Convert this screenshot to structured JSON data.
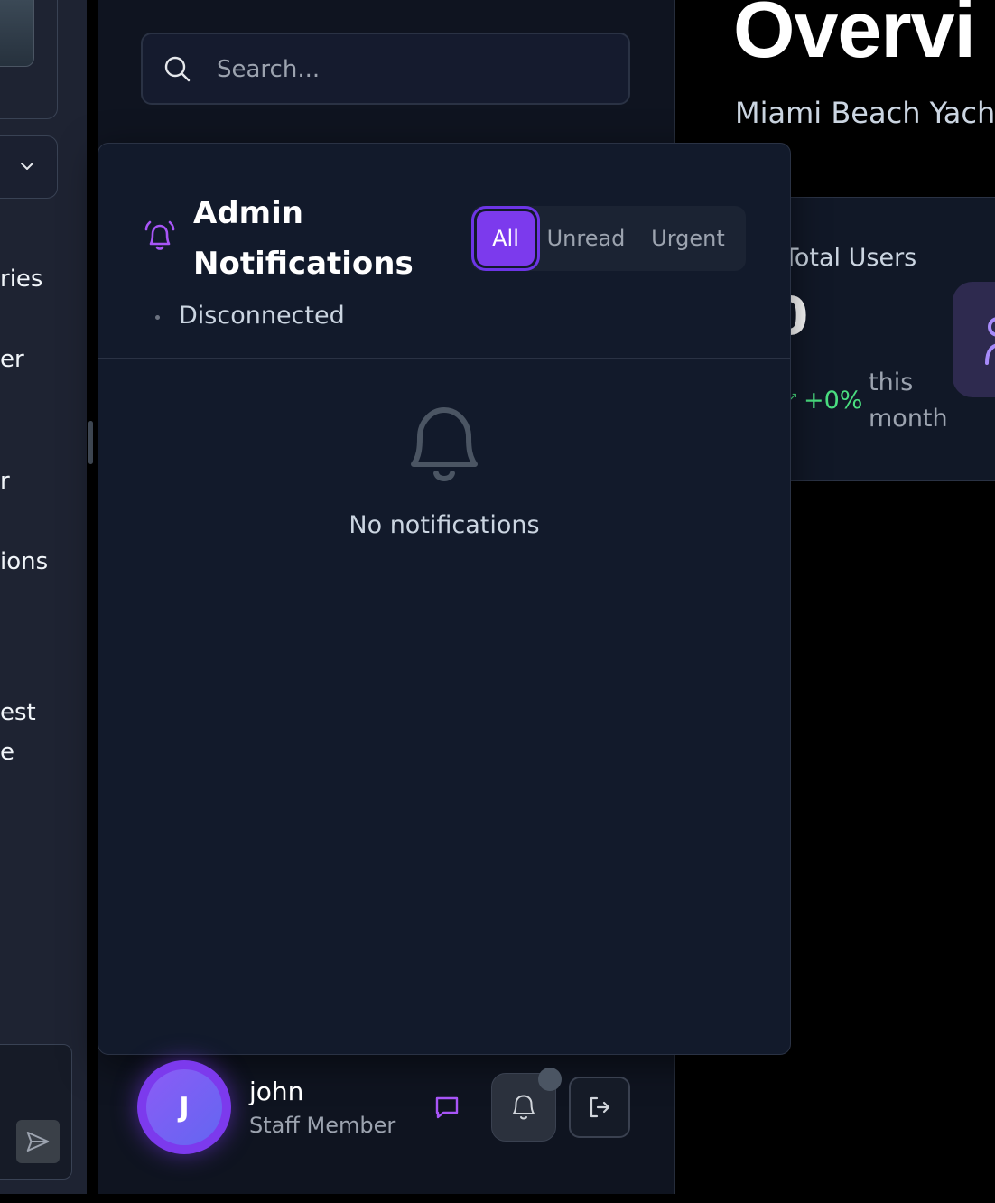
{
  "left_panel": {
    "items": [
      "ries",
      "er",
      "r",
      "ions",
      "est",
      "e"
    ]
  },
  "search": {
    "placeholder": "Search..."
  },
  "main": {
    "title": "Overvi",
    "subtitle": "Miami Beach Yach"
  },
  "stat_card": {
    "label": "Total Users",
    "value": "0",
    "trend": "+0%",
    "period": "this month"
  },
  "notifications": {
    "title": "Admin Notifications",
    "status": "Disconnected",
    "filters": {
      "all": "All",
      "unread": "Unread",
      "urgent": "Urgent"
    },
    "active_filter": "All",
    "empty_text": "No notifications"
  },
  "user": {
    "initial": "J",
    "name": "john",
    "role": "Staff Member"
  },
  "colors": {
    "accent": "#7c3aed",
    "trend_positive": "#4ade80",
    "panel_bg": "#121a2b",
    "page_bg": "#000000"
  },
  "icons": {
    "search": "search-icon",
    "alarm": "alarm-icon",
    "empty": "bell-icon",
    "chat": "chat-icon",
    "bell": "bell-icon",
    "logout": "logout-icon",
    "send": "send-icon",
    "chevron": "chevron-down-icon"
  }
}
